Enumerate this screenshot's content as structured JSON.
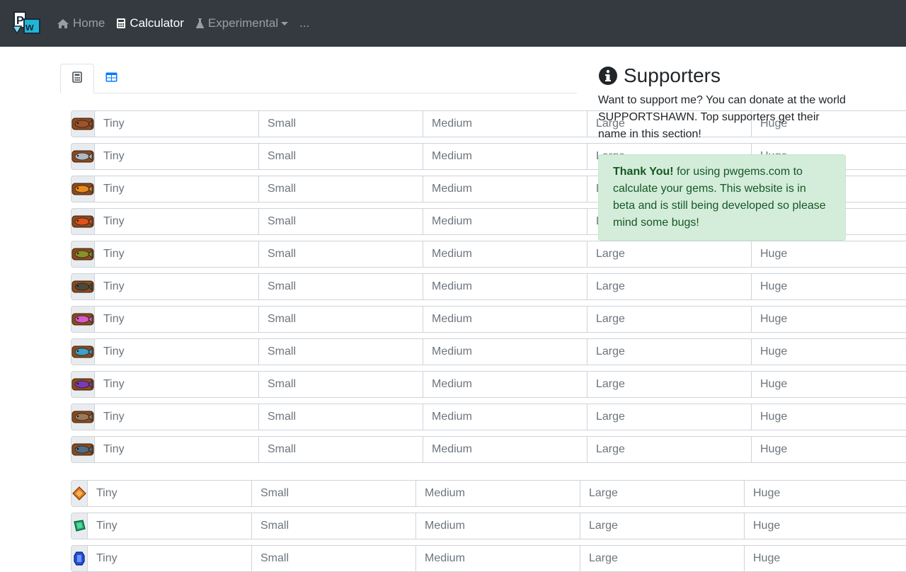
{
  "navbar": {
    "brand": "pw",
    "links": [
      {
        "label": "Home",
        "icon": "home-icon",
        "active": false
      },
      {
        "label": "Calculator",
        "icon": "calculator-icon",
        "active": true
      },
      {
        "label": "Experimental",
        "icon": "flask-icon",
        "active": false,
        "dropdown": true
      },
      {
        "label": "...",
        "active": false
      }
    ]
  },
  "tabs": [
    {
      "icon": "calculator-icon",
      "active": true
    },
    {
      "icon": "table-icon",
      "active": false
    }
  ],
  "placeholders": [
    "Tiny",
    "Small",
    "Medium",
    "Large",
    "Huge"
  ],
  "fish_rows": [
    {
      "icon": "fish-brown-icon",
      "color": "#a0522d"
    },
    {
      "icon": "fish-silver-icon",
      "color": "#b0b8c0"
    },
    {
      "icon": "fish-clown-icon",
      "color": "#e88a1a"
    },
    {
      "icon": "fish-red-icon",
      "color": "#e2531c"
    },
    {
      "icon": "fish-green-icon",
      "color": "#8a8f2a"
    },
    {
      "icon": "fish-dark-icon",
      "color": "#4a4a3a"
    },
    {
      "icon": "fish-pink-icon",
      "color": "#d65cc7"
    },
    {
      "icon": "fish-blue-icon",
      "color": "#3aa3c9"
    },
    {
      "icon": "fish-purple-icon",
      "color": "#7a3ab8"
    },
    {
      "icon": "fish-tan-icon",
      "color": "#9a7a5a"
    },
    {
      "icon": "fish-steel-icon",
      "color": "#4f6d86"
    }
  ],
  "gem_rows": [
    {
      "icon": "gem-orange-icon",
      "color": "#e07a1f"
    },
    {
      "icon": "gem-green-icon",
      "color": "#1fa36a"
    },
    {
      "icon": "gem-blue-icon",
      "color": "#1f4fe0"
    }
  ],
  "sidebar": {
    "title": "Supporters",
    "text": "Want to support me? You can donate at the world SUPPORTSHAWN. Top supporters get their name in this section!",
    "alert_bold": "Thank You!",
    "alert_text": " for using pwgems.com to calculate your gems. This website is in beta and is still being developed so please mind some bugs!"
  },
  "colors": {
    "navbar_bg": "#343a40",
    "accent": "#007bff",
    "alert_bg": "#d4edda",
    "alert_text": "#155724"
  }
}
